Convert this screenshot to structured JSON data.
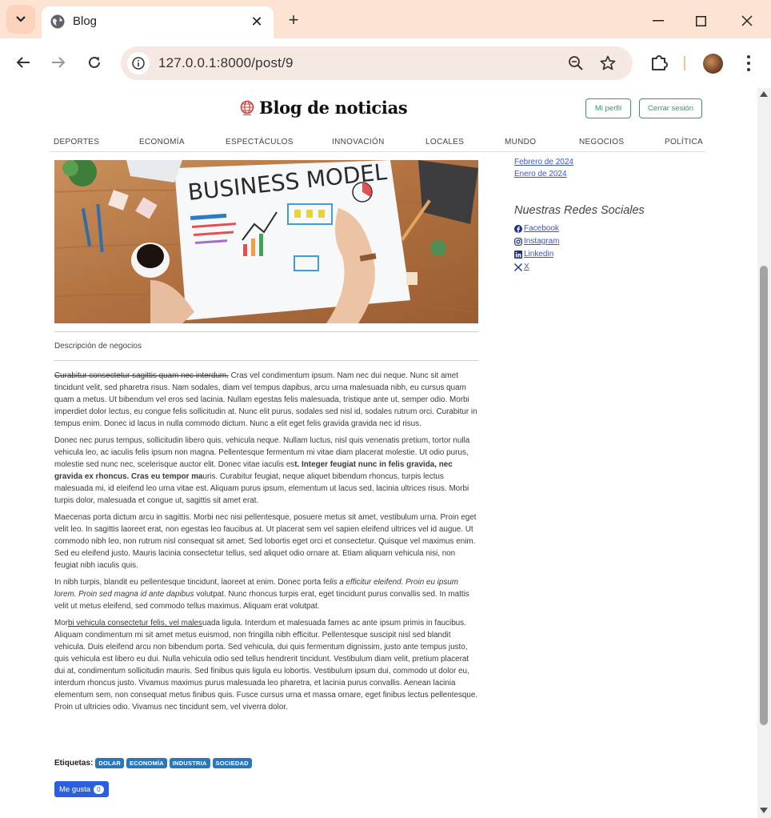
{
  "browser": {
    "tab_title": "Blog",
    "url": "127.0.0.1:8000/post/9"
  },
  "header": {
    "site_title": "Blog de noticias",
    "profile_button": "Mi perfil",
    "logout_button": "Cerrar sesión"
  },
  "categories": [
    "DEPORTES",
    "ECONOMÍA",
    "ESPECTÁCULOS",
    "INNOVACIÓN",
    "LOCALES",
    "MUNDO",
    "NEGOCIOS",
    "POLÍTICA"
  ],
  "post": {
    "image_caption": "Descripción de negocios",
    "image_text": "BUSINESS MODEL",
    "paragraphs": [
      {
        "strike": "Curabitur consectetur sagittis quam nec interdum.",
        "text": " Cras vel condimentum ipsum. Nam nec dui neque. Nunc sit amet tincidunt velit, sed pharetra risus. Nam sodales, diam vel tempus dapibus, arcu urna malesuada nibh, eu cursus quam quam a metus. Ut bibendum vel eros sed lacinia. Nullam egestas felis malesuada, tristique ante ut, semper odio. Morbi imperdiet dolor lectus, eu congue felis sollicitudin at. Nunc elit purus, sodales sed nisl id, sodales rutrum orci. Curabitur in tempus enim. Donec id lacus in nulla commodo dictum. Nunc a elit eget felis gravida gravida nec id risus."
      },
      {
        "text_before": "Donec nec purus tempus, sollicitudin libero quis, vehicula neque. Nullam luctus, nisl quis venenatis pretium, tortor nulla vehicula leo, ac iaculis felis ipsum non magna. Pellentesque fermentum mi vitae diam placerat molestie. Ut odio purus, molestie sed nunc nec, scelerisque auctor elit. Donec vitae iaculis es",
        "bold": "t. Integer feugiat nunc in felis gravida, nec gravida ex rhoncus. Cras eu tempor ma",
        "text_after": "uris. Curabitur feugiat, neque aliquet bibendum rhoncus, turpis lectus malesuada mi, id eleifend leo urna vitae est. Aliquam purus ipsum, elementum ut lacus sed, lacinia ultrices risus. Morbi turpis dolor, malesuada et congue ut, sagittis sit amet erat."
      },
      {
        "text": "Maecenas porta dictum arcu in sagittis. Morbi nec nisi pellentesque, posuere metus sit amet, vestibulum urna. Proin eget velit leo. In sagittis laoreet erat, non egestas leo faucibus at. Ut placerat sem vel sapien eleifend ultrices vel id augue. Ut commodo nibh leo, non rutrum nisl consequat sit amet. Sed lobortis eget orci et consectetur. Quisque vel maximus enim. Sed eu eleifend justo. Mauris lacinia consectetur tellus, sed aliquet odio ornare at. Etiam aliquam vehicula nisi, non feugiat nibh iaculis quis."
      },
      {
        "text_before": "In nibh turpis, blandit eu pellentesque tincidunt, laoreet at enim. Donec porta fe",
        "italic": "lis a efficitur eleifend. Proin eu ipsum lorem. Proin sed magna id ante dapibus",
        "text_after": " volutpat. Nunc rhoncus turpis erat, eget tincidunt purus convallis sed. In mattis velit ut metus eleifend, sed commodo tellus maximus. Aliquam erat volutpat."
      },
      {
        "text_before": "Mor",
        "underline": "bi vehicula consectetur felis, vel males",
        "text_after": "uada ligula. Interdum et malesuada fames ac ante ipsum primis in faucibus. Aliquam condimentum mi sit amet metus euismod, non fringilla nibh efficitur. Pellentesque suscipit nisl sed blandit vehicula. Duis eleifend arcu non bibendum porta. Sed vehicula, dui quis fermentum dignissim, justo ante tempus justo, quis vehicula est libero eu dui. Nulla vehicula odio sed tellus hendrerit tincidunt. Vestibulum diam velit, pretium placerat dui at, condimentum sollicitudin mauris. Sed finibus quis ligula eu lobortis. Vestibulum ipsum dui, commodo ut dolor eu, interdum rhoncus justo. Vivamus maximus purus malesuada leo pharetra, et lacinia purus convallis. Aenean lacinia elementum sem, non consequat metus finibus quis. Fusce cursus urna et massa ornare, eget finibus lectus pellentesque. Proin ut ultricies odio. Vivamus nec tincidunt sem, vel viverra dolor."
      }
    ],
    "tags_label": "Etiquetas:",
    "tags": [
      "DOLAR",
      "ECONOMÍA",
      "INDUSTRIA",
      "SOCIEDAD"
    ],
    "like_label": "Me gusta",
    "like_count": "0"
  },
  "sidebar": {
    "archive": [
      "Febrero de 2024",
      "Enero de 2024"
    ],
    "social_heading": "Nuestras Redes Sociales",
    "social": [
      {
        "label": " Facebook",
        "icon": "facebook-icon"
      },
      {
        "label": " Instagram",
        "icon": "instagram-icon"
      },
      {
        "label": " Linkedin",
        "icon": "linkedin-icon"
      },
      {
        "label": " X",
        "icon": "x-icon"
      }
    ]
  },
  "colors": {
    "chrome_bg": "#fde3d2",
    "header_button": "#2f9d68",
    "link": "#3b55d9",
    "tag": "#2a77b9",
    "like_button": "#2c5fe0"
  }
}
